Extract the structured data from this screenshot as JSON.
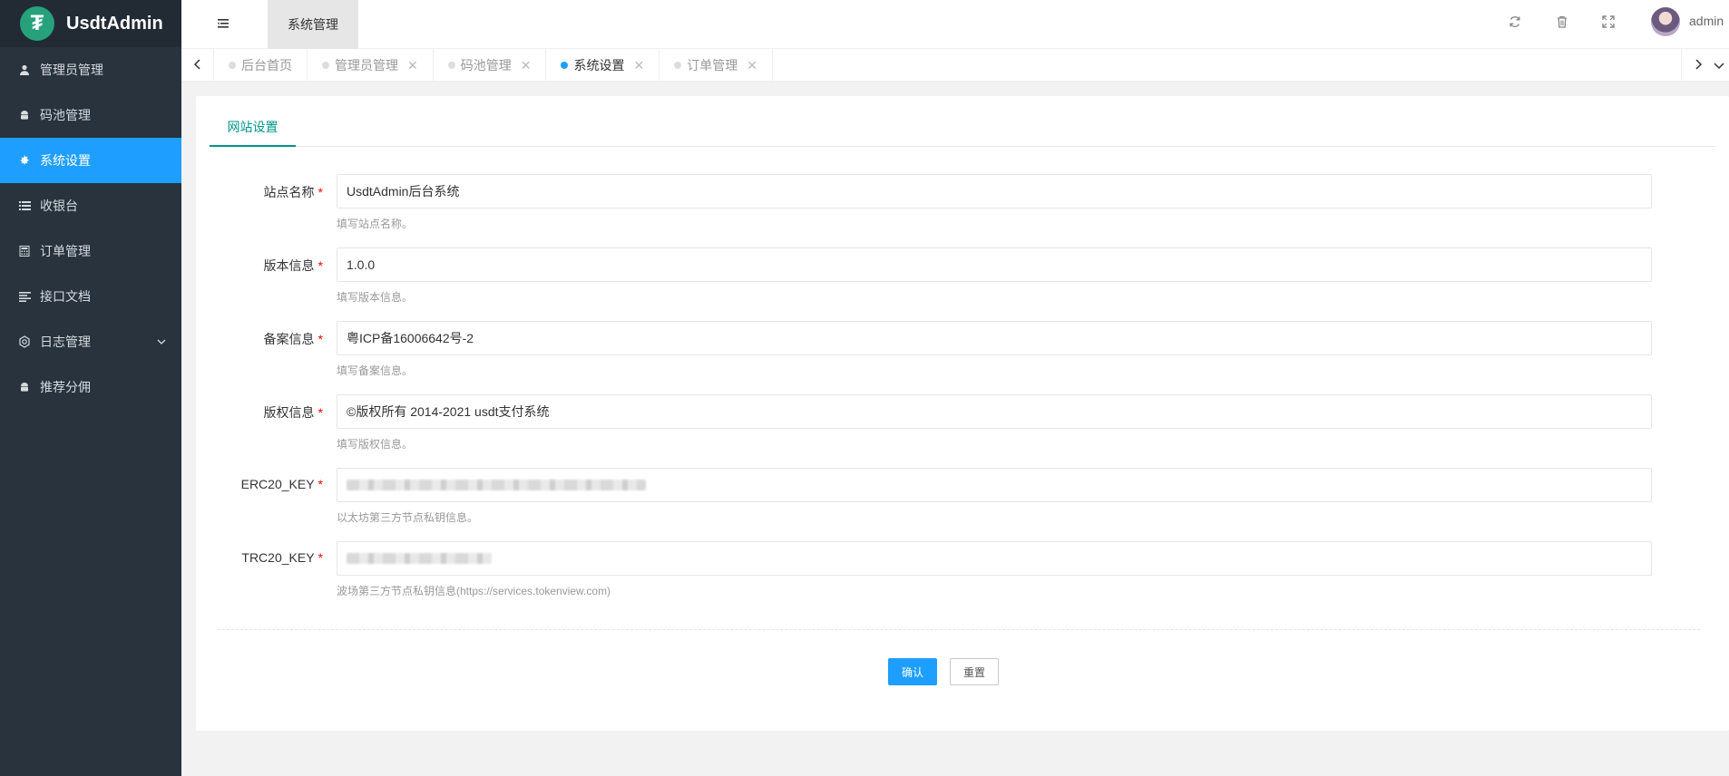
{
  "app": {
    "title": "UsdtAdmin",
    "logo_glyph": "₮"
  },
  "header": {
    "title": "系统管理",
    "username": "admin"
  },
  "sidebar": {
    "items": [
      {
        "label": "管理员管理",
        "icon": "user-icon"
      },
      {
        "label": "码池管理",
        "icon": "android-icon"
      },
      {
        "label": "系统设置",
        "icon": "gear-icon",
        "active": true
      },
      {
        "label": "收银台",
        "icon": "list-icon"
      },
      {
        "label": "订单管理",
        "icon": "calculator-icon"
      },
      {
        "label": "接口文档",
        "icon": "align-left-icon"
      },
      {
        "label": "日志管理",
        "icon": "cog-outline-icon",
        "has_children": true
      },
      {
        "label": "推荐分佣",
        "icon": "android-icon"
      }
    ]
  },
  "tabs": [
    {
      "label": "后台首页",
      "closable": false
    },
    {
      "label": "管理员管理",
      "closable": true
    },
    {
      "label": "码池管理",
      "closable": true
    },
    {
      "label": "系统设置",
      "closable": true,
      "active": true
    },
    {
      "label": "订单管理",
      "closable": true
    }
  ],
  "card": {
    "tab_label": "网站设置"
  },
  "form": {
    "fields": [
      {
        "label": "站点名称",
        "value": "UsdtAdmin后台系统",
        "help": "填写站点名称。"
      },
      {
        "label": "版本信息",
        "value": "1.0.0",
        "help": "填写版本信息。"
      },
      {
        "label": "备案信息",
        "value": "粤ICP备16006642号-2",
        "help": "填写备案信息。"
      },
      {
        "label": "版权信息",
        "value": "©版权所有 2014-2021 usdt支付系统",
        "help": "填写版权信息。"
      },
      {
        "label": "ERC20_KEY",
        "value": "",
        "help": "以太坊第三方节点私钥信息。"
      },
      {
        "label": "TRC20_KEY",
        "value": "",
        "help": "波场第三方节点私钥信息(https://services.tokenview.com)"
      }
    ],
    "required_mark": "*",
    "submit_label": "确认",
    "reset_label": "重置"
  },
  "colors": {
    "sidebar_bg": "#28333e",
    "accent": "#1e9fff",
    "tab_accent": "#009688",
    "required": "#ff0000"
  }
}
